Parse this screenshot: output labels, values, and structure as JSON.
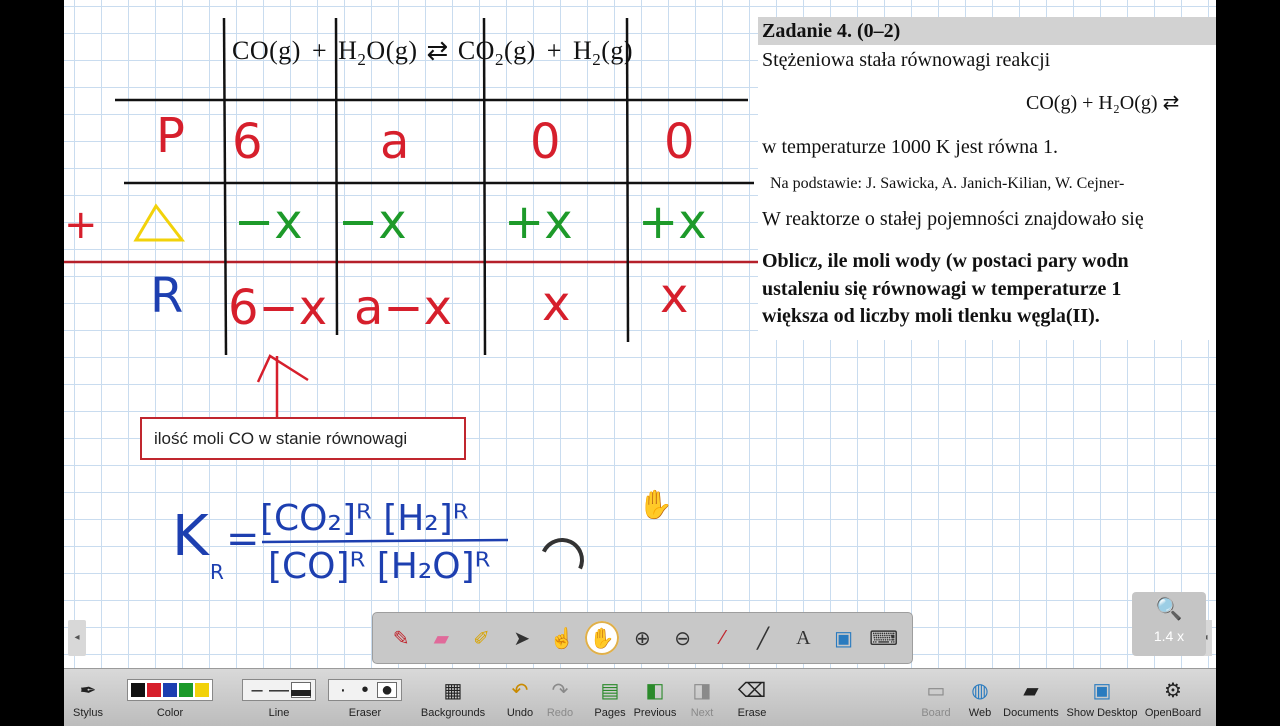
{
  "board": {
    "header_equation": {
      "co": "CO",
      "g1": "(g)",
      "plus1": "+",
      "h2o_h": "H",
      "h2o_sub": "2",
      "h2o_o": "O",
      "g2": "(g)",
      "arrow": "⇄",
      "co2_co": "CO",
      "co2_sub": "2",
      "g3": "(g)",
      "plus2": "+",
      "h2_h": "H",
      "h2_sub": "2",
      "g4": "(g)"
    },
    "table": {
      "row_labels": [
        "P",
        "Δ",
        "R"
      ],
      "row_p": [
        "6",
        "a",
        "0",
        "0"
      ],
      "row_delta": [
        "−x",
        "−x",
        "+x",
        "+x"
      ],
      "row_r": [
        "6−x",
        "a−x",
        "x",
        "x"
      ],
      "plus_mark": "+"
    },
    "callout_text": "ilość moli CO w stanie równowagi",
    "formula": {
      "k": "K",
      "k_sub": "R",
      "eq": "=",
      "numerator": "[CO₂]ᴿ [H₂]ᴿ",
      "denominator": "[CO]ᴿ [H₂O]ᴿ"
    }
  },
  "document": {
    "title": "Zadanie 4. (0–2)",
    "line1": "Stężeniowa stała równowagi reakcji",
    "equation": "CO(g) + H₂O(g) ⇄",
    "line2": "w temperaturze 1000 K jest równa 1.",
    "source": "Na podstawie: J. Sawicka, A. Janich-Kilian, W. Cejner-",
    "line3": "W reaktorze o stałej pojemności znajdowało się",
    "bold1": "Oblicz, ile moli wody (w postaci pary wodn",
    "bold2": "ustaleniu się równowagi w temperaturze 1",
    "bold3": "większa od liczby moli tlenku węgla(II)."
  },
  "zoom": {
    "label": "1.4 x"
  },
  "bottom_toolbar": {
    "stylus": "Stylus",
    "color": "Color",
    "line": "Line",
    "eraser": "Eraser",
    "backgrounds": "Backgrounds",
    "undo": "Undo",
    "redo": "Redo",
    "pages": "Pages",
    "previous": "Previous",
    "next": "Next",
    "erase": "Erase",
    "board": "Board",
    "web": "Web",
    "documents": "Documents",
    "show_desktop": "Show Desktop",
    "openboard": "OpenBoard"
  },
  "colors": {
    "ink_black": "#111111",
    "ink_red": "#d61f2c",
    "ink_green": "#1d9a2a",
    "ink_blue": "#1d3fb0",
    "ink_yellow": "#f2d20a",
    "rule_red": "#b5202a"
  },
  "icons": {
    "tools": [
      "pen-icon",
      "highlighter-eraser-icon",
      "marker-icon",
      "pointer-icon",
      "laser-hand-icon",
      "hand-icon",
      "zoom-in-icon",
      "zoom-out-icon",
      "laser-pen-icon",
      "line-icon",
      "text-icon",
      "capture-icon",
      "keyboard-icon"
    ]
  }
}
